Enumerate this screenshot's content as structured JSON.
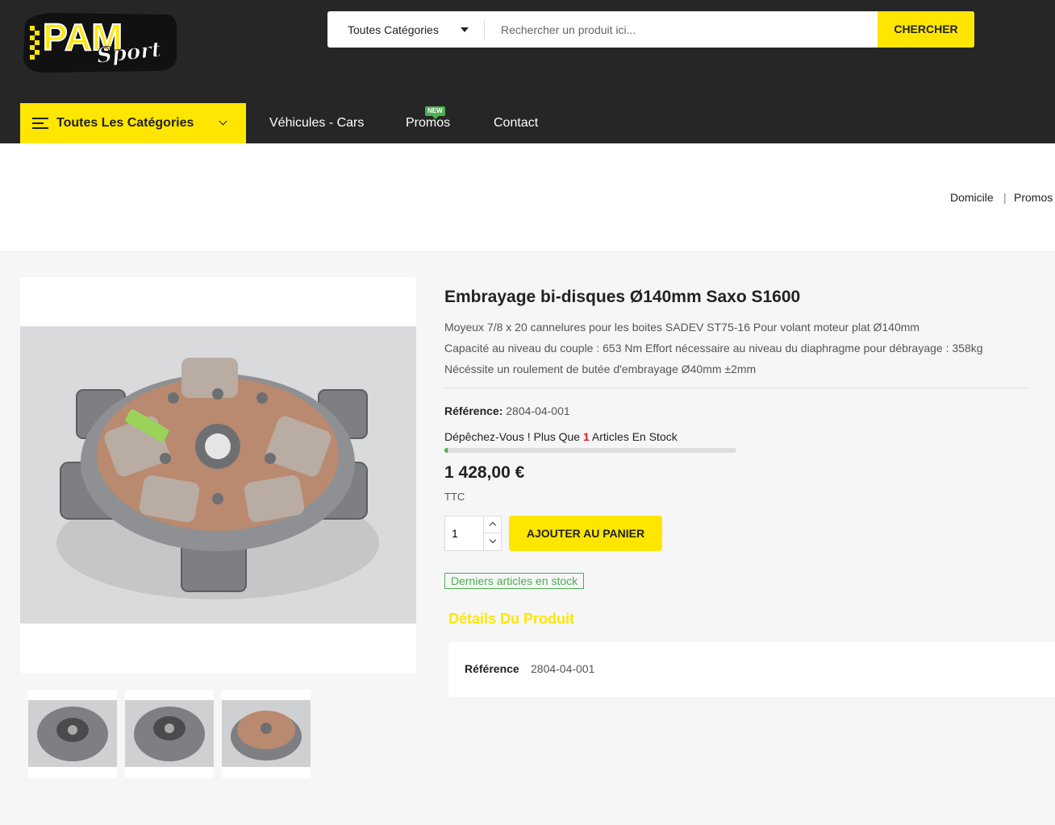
{
  "header": {
    "logo_main": "PAM",
    "logo_sub": "Sport",
    "search": {
      "category": "Toutes Catégories",
      "placeholder": "Rechercher un produit ici...",
      "button": "CHERCHER"
    },
    "all_categories": "Toutes Les Catégories",
    "nav": [
      "Véhicules - Cars",
      "Promos",
      "Contact"
    ],
    "new_badge": "NEW"
  },
  "breadcrumb": [
    "Domicile",
    "Promos"
  ],
  "product": {
    "title": "Embrayage bi-disques Ø140mm Saxo S1600",
    "description": [
      "Moyeux 7/8 x 20 cannelures pour les boites SADEV ST75-16 Pour volant moteur plat Ø140mm",
      "Capacité au niveau du couple : 653 Nm Effort nécessaire au niveau du diaphragme pour débrayage : 358kg",
      "Nécéssite un roulement de butée d'embrayage Ø40mm ±2mm"
    ],
    "reference_label": "Référence:",
    "reference": "2804-04-001",
    "stock_prefix": "Dépêchez-Vous ! Plus Que",
    "stock_count": "1",
    "stock_suffix": "Articles En Stock",
    "stock_fraction": 0.01,
    "price": "1 428,00 €",
    "tax": "TTC",
    "quantity": "1",
    "add_to_cart": "AJOUTER AU PANIER",
    "availability": "Derniers articles en stock",
    "details_title": "Détails Du Produit",
    "details": [
      {
        "key": "Référence",
        "value": "2804-04-001"
      }
    ]
  },
  "colors": {
    "accent": "#ffe600",
    "header_bg": "#262626",
    "stock_green": "#4caf50",
    "stock_red": "#e31b23"
  }
}
